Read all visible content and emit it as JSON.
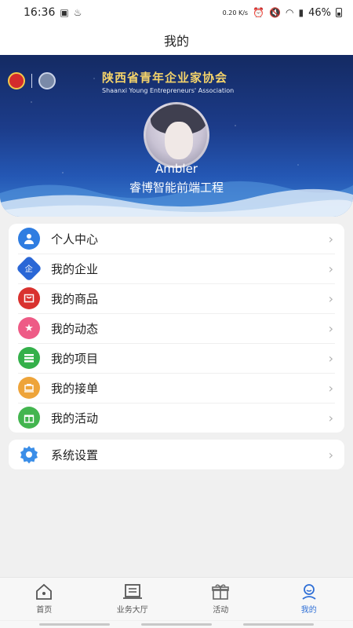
{
  "status_bar": {
    "time": "16:36",
    "net_speed": "0.20 K/s",
    "battery": "46%"
  },
  "header": {
    "title": "我的"
  },
  "banner": {
    "association_cn": "陕西省青年企业家协会",
    "association_en": "Shaanxi Young Entrepreneurs' Association",
    "username": "Ambler",
    "company": "睿博智能前端工程"
  },
  "menu": [
    {
      "label": "个人中心",
      "icon": "user-icon",
      "color": "#2f7de1"
    },
    {
      "label": "我的企业",
      "icon": "enterprise-icon",
      "color": "#2a67d6",
      "glyph": "企"
    },
    {
      "label": "我的商品",
      "icon": "goods-icon",
      "color": "#d9322f"
    },
    {
      "label": "我的动态",
      "icon": "star-icon",
      "color": "#ee5b86"
    },
    {
      "label": "我的项目",
      "icon": "project-list-icon",
      "color": "#34b04a"
    },
    {
      "label": "我的接单",
      "icon": "order-icon",
      "color": "#eea43a"
    },
    {
      "label": "我的活动",
      "icon": "gift-icon",
      "color": "#43b54f"
    }
  ],
  "settings": {
    "label": "系统设置",
    "icon": "gear-icon",
    "color": "#3b8ee8"
  },
  "tabs": [
    {
      "label": "首页",
      "icon": "home-icon"
    },
    {
      "label": "业务大厅",
      "icon": "business-hall-icon"
    },
    {
      "label": "活动",
      "icon": "activity-gift-icon"
    },
    {
      "label": "我的",
      "icon": "profile-icon",
      "active": true
    }
  ]
}
